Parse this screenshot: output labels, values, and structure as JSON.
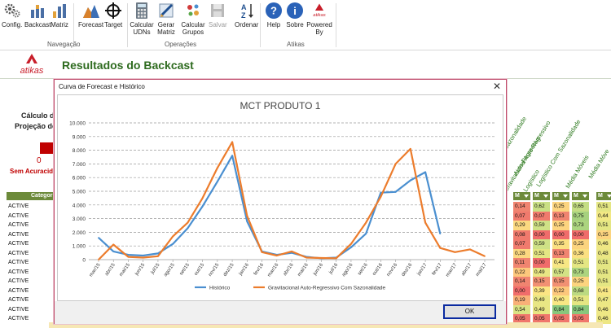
{
  "ribbon": {
    "buttons": [
      {
        "id": "config",
        "label": "Config.",
        "icon": "gears-icon",
        "disabled": false
      },
      {
        "id": "backcast",
        "label": "Backcast",
        "icon": "bar-chart-icon",
        "disabled": false
      },
      {
        "id": "matriz",
        "label": "Matriz",
        "icon": "matrix-chart-icon",
        "disabled": false
      },
      {
        "id": "forecast",
        "label": "Forecast",
        "icon": "mountain-chart-icon",
        "disabled": false
      },
      {
        "id": "target",
        "label": "Target",
        "icon": "crosshair-icon",
        "disabled": false
      },
      {
        "id": "calcular-udns",
        "label": "Calcular UDNs",
        "icon": "calculator-icon",
        "disabled": false
      },
      {
        "id": "gerar-matriz",
        "label": "Gerar Matriz",
        "icon": "pencil-board-icon",
        "disabled": false
      },
      {
        "id": "calcular-grupos",
        "label": "Calcular Grupos",
        "icon": "dots-cluster-icon",
        "disabled": false
      },
      {
        "id": "salvar",
        "label": "Salvar",
        "icon": "floppy-disk-icon",
        "disabled": true
      },
      {
        "id": "ordenar",
        "label": "Ordenar",
        "icon": "sort-az-icon",
        "disabled": false
      },
      {
        "id": "help",
        "label": "Help",
        "icon": "question-icon",
        "disabled": false
      },
      {
        "id": "sobre",
        "label": "Sobre",
        "icon": "info-icon",
        "disabled": false
      },
      {
        "id": "powered",
        "label": "Powered By",
        "icon": "atikas-logo-icon",
        "disabled": false
      }
    ],
    "groups": [
      "Navegação",
      "Operações",
      "Atikas"
    ]
  },
  "sheet": {
    "logo_text": "atikas",
    "title": "Resultados do Backcast",
    "calc_label": "Cálculo da",
    "proj_label": "Projeção de",
    "zero": "0",
    "sem": "Sem Acuracidade",
    "categoria_header": "Categoria",
    "statuses": [
      "ACTIVE",
      "ACTIVE",
      "ACTIVE",
      "ACTIVE",
      "ACTIVE",
      "ACTIVE",
      "ACTIVE",
      "ACTIVE",
      "ACTIVE",
      "ACTIVE",
      "ACTIVE",
      "ACTIVE",
      "ACTIVE"
    ],
    "rotated_labels": [
      "Sazonalidade",
      "Auto-Regressivo",
      "Gravitacional Auto-Regressivo",
      "Logístico",
      "Logístico Com Sazonalidade",
      "Média Móveis",
      "Média Móve"
    ],
    "mhead": "M",
    "grid": [
      [
        {
          "v": "0,14",
          "c": "#f08470"
        },
        {
          "v": "0,62",
          "c": "#c9df84"
        },
        {
          "v": "0,25",
          "c": "#fcd47f"
        },
        {
          "v": "0,65",
          "c": "#c4dd83"
        },
        {
          "v": "0,51",
          "c": "#e4e683"
        }
      ],
      [
        {
          "v": "0,07",
          "c": "#f07a6d"
        },
        {
          "v": "0,07",
          "c": "#f07a6d"
        },
        {
          "v": "0,13",
          "c": "#f08470"
        },
        {
          "v": "0,75",
          "c": "#a6d17e"
        },
        {
          "v": "0,44",
          "c": "#f2e884"
        }
      ],
      [
        {
          "v": "0,29",
          "c": "#fbd880"
        },
        {
          "v": "0,59",
          "c": "#cfe186"
        },
        {
          "v": "0,25",
          "c": "#fcd47f"
        },
        {
          "v": "0,73",
          "c": "#acd47f"
        },
        {
          "v": "0,51",
          "c": "#e4e683"
        }
      ],
      [
        {
          "v": "0,08",
          "c": "#f07a6d"
        },
        {
          "v": "0,00",
          "c": "#f06c6b"
        },
        {
          "v": "0,00",
          "c": "#f06c6b"
        },
        {
          "v": "0,00",
          "c": "#f06c6b"
        },
        {
          "v": "0,25",
          "c": "#fcd47f"
        }
      ],
      [
        {
          "v": "0,07",
          "c": "#f07a6d"
        },
        {
          "v": "0,59",
          "c": "#cfe186"
        },
        {
          "v": "0,35",
          "c": "#fbe082"
        },
        {
          "v": "0,25",
          "c": "#fcd47f"
        },
        {
          "v": "0,46",
          "c": "#eee784"
        }
      ],
      [
        {
          "v": "0,28",
          "c": "#fbd880"
        },
        {
          "v": "0,51",
          "c": "#e4e683"
        },
        {
          "v": "0,13",
          "c": "#f08470"
        },
        {
          "v": "0,36",
          "c": "#fbe082"
        },
        {
          "v": "0,48",
          "c": "#eae684"
        }
      ],
      [
        {
          "v": "0,11",
          "c": "#f08470"
        },
        {
          "v": "0,00",
          "c": "#f06c6b"
        },
        {
          "v": "0,41",
          "c": "#f7e784"
        },
        {
          "v": "0,51",
          "c": "#e4e683"
        },
        {
          "v": "0,51",
          "c": "#e4e683"
        }
      ],
      [
        {
          "v": "0,22",
          "c": "#fcc77c"
        },
        {
          "v": "0,49",
          "c": "#e8e684"
        },
        {
          "v": "0,57",
          "c": "#d3e285"
        },
        {
          "v": "0,73",
          "c": "#acd47f"
        },
        {
          "v": "0,51",
          "c": "#e4e683"
        }
      ],
      [
        {
          "v": "0,14",
          "c": "#f08470"
        },
        {
          "v": "0,15",
          "c": "#f19073"
        },
        {
          "v": "0,15",
          "c": "#f19073"
        },
        {
          "v": "0,25",
          "c": "#fcd47f"
        },
        {
          "v": "0,51",
          "c": "#e4e683"
        }
      ],
      [
        {
          "v": "0,00",
          "c": "#f06c6b"
        },
        {
          "v": "0,39",
          "c": "#fbe583"
        },
        {
          "v": "0,22",
          "c": "#fcc77c"
        },
        {
          "v": "0,68",
          "c": "#bcda82"
        },
        {
          "v": "0,41",
          "c": "#f7e784"
        }
      ],
      [
        {
          "v": "0,19",
          "c": "#f8b078"
        },
        {
          "v": "0,49",
          "c": "#e8e684"
        },
        {
          "v": "0,40",
          "c": "#f8e784"
        },
        {
          "v": "0,51",
          "c": "#e4e683"
        },
        {
          "v": "0,47",
          "c": "#ece784"
        }
      ],
      [
        {
          "v": "0,54",
          "c": "#dae385"
        },
        {
          "v": "0,49",
          "c": "#e8e684"
        },
        {
          "v": "0,84",
          "c": "#88c77c"
        },
        {
          "v": "0,84",
          "c": "#88c77c"
        },
        {
          "v": "0,46",
          "c": "#eee784"
        }
      ],
      [
        {
          "v": "0,05",
          "c": "#f0766c"
        },
        {
          "v": "0,05",
          "c": "#f0766c"
        },
        {
          "v": "0,05",
          "c": "#f0766c"
        },
        {
          "v": "0,05",
          "c": "#f0766c"
        },
        {
          "v": "0,46",
          "c": "#eee784"
        }
      ]
    ]
  },
  "dialog": {
    "title": "Curva de Forecast e Histórico",
    "close": "✕",
    "ok": "OK"
  },
  "chart_data": {
    "type": "line",
    "title": "MCT PRODUTO 1",
    "xlabel": "",
    "ylabel": "",
    "ylim": [
      0,
      10000
    ],
    "yticks": [
      "0",
      "1.000",
      "2.000",
      "3.000",
      "4.000",
      "5.000",
      "6.000",
      "7.000",
      "8.000",
      "9.000",
      "10.000"
    ],
    "categories": [
      "mar/15",
      "abr/15",
      "mai/15",
      "jun/15",
      "jul/15",
      "ago/15",
      "set/15",
      "out/15",
      "nov/15",
      "dez/15",
      "jan/16",
      "fev/16",
      "mar/16",
      "abr/16",
      "mai/16",
      "jun/16",
      "jul/16",
      "ago/16",
      "set/16",
      "out/16",
      "nov/16",
      "dez/16",
      "jan/17",
      "fev/17",
      "mar/17",
      "abr/17",
      "mai/17"
    ],
    "xtick_labels": [
      "mar/15",
      "mai/15",
      "jul/15",
      "set/15",
      "nov/15",
      "jan/16",
      "mar/16",
      "mai/16",
      "jul/16",
      "set/16",
      "nov/16",
      "jan/17",
      "mar/17",
      "mai/17",
      "abr/15",
      "jun/15",
      "ago/15",
      "out/15",
      "dez/15",
      "fev/16",
      "abr/16",
      "jun/16",
      "ago/16",
      "out/16",
      "dez/16",
      "fev/17",
      "abr/17"
    ],
    "series": [
      {
        "name": "Histórico",
        "color": "#4a8fd0",
        "values": [
          1600,
          600,
          350,
          300,
          450,
          1150,
          2300,
          3900,
          5700,
          7600,
          2800,
          600,
          350,
          500,
          200,
          100,
          150,
          900,
          1900,
          4900,
          4950,
          5800,
          6400,
          1900,
          null,
          null,
          null
        ]
      },
      {
        "name": "Gravitacional Auto-Regressivo Com Sazonalidade",
        "color": "#ec7c2c",
        "values": [
          0,
          1100,
          200,
          150,
          250,
          1700,
          2700,
          4500,
          6700,
          8600,
          3200,
          550,
          300,
          600,
          150,
          120,
          100,
          1150,
          2700,
          4600,
          7000,
          8100,
          2700,
          850,
          550,
          750,
          250
        ]
      }
    ],
    "legend": "bottom",
    "grid": true
  }
}
